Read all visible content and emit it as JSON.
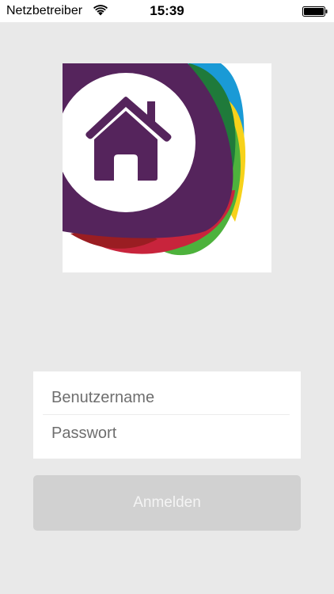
{
  "status_bar": {
    "carrier": "Netzbetreiber",
    "time": "15:39",
    "wifi_icon": "wifi-icon",
    "battery_icon": "battery-full-icon"
  },
  "logo": {
    "icon": "house-icon",
    "colors": {
      "purple": "#55245c",
      "blue": "#1a9ad6",
      "green": "#4db23c",
      "dark_green": "#1f7a3a",
      "yellow": "#f7d21a",
      "red": "#c8243c",
      "dark_red": "#9a1d22"
    }
  },
  "login_form": {
    "username_placeholder": "Benutzername",
    "password_placeholder": "Passwort",
    "login_label": "Anmelden"
  },
  "colors": {
    "background": "#e9e9e9",
    "button_disabled": "#d1d1d1",
    "button_text": "#f4f4f4"
  }
}
